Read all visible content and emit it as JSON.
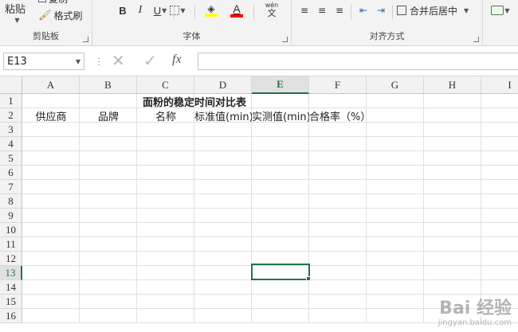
{
  "ribbon": {
    "clipboard": {
      "label": "剪贴板",
      "paste": "粘贴",
      "copy": "复制",
      "format_painter": "格式刷"
    },
    "font": {
      "label": "字体",
      "bold": "B",
      "italic": "I",
      "underline": "U",
      "font_color_letter": "A",
      "phonetic_top": "wén",
      "phonetic_bottom": "文",
      "fill_color": "#ffff00",
      "text_color": "#ff0000"
    },
    "alignment": {
      "label": "对齐方式",
      "merge_center": "合并后居中"
    }
  },
  "formula_bar": {
    "name_box": "E13",
    "fx": "fx",
    "value": ""
  },
  "sheet": {
    "columns": [
      "A",
      "B",
      "C",
      "D",
      "E",
      "F",
      "G",
      "H",
      "I"
    ],
    "selected_column": "E",
    "rows": [
      "1",
      "2",
      "3",
      "4",
      "5",
      "6",
      "7",
      "8",
      "9",
      "10",
      "11",
      "12",
      "13",
      "14",
      "15",
      "16"
    ],
    "selected_row": "13",
    "title": "面粉的稳定时间对比表",
    "headers": [
      "供应商",
      "品牌",
      "名称",
      "标准值(min)",
      "实测值(min)",
      "合格率（%）"
    ],
    "active_cell": "E13"
  },
  "watermark": {
    "line1": "Bai 经验",
    "line2": "jingyan.baidu.com"
  },
  "colors": {
    "accent": "#217346"
  }
}
